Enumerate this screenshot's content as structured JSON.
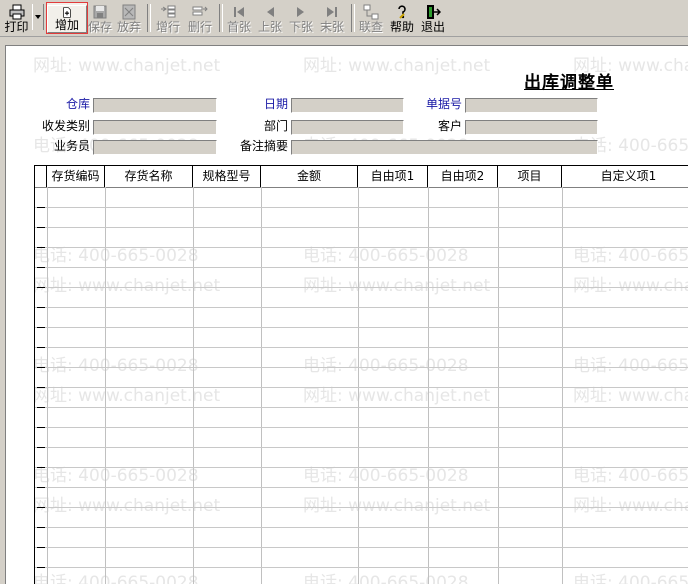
{
  "toolbar": {
    "buttons": [
      {
        "label": "打印",
        "icon": "printer-icon",
        "enabled": true
      },
      {
        "label": "增加",
        "icon": "add-document-icon",
        "enabled": true,
        "highlighted": true
      },
      {
        "label": "保存",
        "icon": "save-icon",
        "enabled": false
      },
      {
        "label": "放弃",
        "icon": "discard-icon",
        "enabled": false
      },
      {
        "label": "增行",
        "icon": "add-row-icon",
        "enabled": false
      },
      {
        "label": "删行",
        "icon": "delete-row-icon",
        "enabled": false
      },
      {
        "label": "首张",
        "icon": "first-record-icon",
        "enabled": false
      },
      {
        "label": "上张",
        "icon": "previous-record-icon",
        "enabled": false
      },
      {
        "label": "下张",
        "icon": "next-record-icon",
        "enabled": false
      },
      {
        "label": "末张",
        "icon": "last-record-icon",
        "enabled": false
      },
      {
        "label": "联查",
        "icon": "linked-query-icon",
        "enabled": false
      },
      {
        "label": "帮助",
        "icon": "help-icon",
        "enabled": true
      },
      {
        "label": "退出",
        "icon": "exit-icon",
        "enabled": true
      }
    ]
  },
  "form": {
    "title": "出库调整单",
    "fields": {
      "warehouse": {
        "label": "仓库",
        "value": ""
      },
      "date": {
        "label": "日期",
        "value": ""
      },
      "doc_no": {
        "label": "单据号",
        "value": ""
      },
      "io_type": {
        "label": "收发类别",
        "value": ""
      },
      "department": {
        "label": "部门",
        "value": ""
      },
      "customer": {
        "label": "客户",
        "value": ""
      },
      "salesperson": {
        "label": "业务员",
        "value": ""
      },
      "remark": {
        "label": "备注摘要",
        "value": ""
      }
    }
  },
  "grid": {
    "columns": [
      "存货编码",
      "存货名称",
      "规格型号",
      "金额",
      "自由项1",
      "自由项2",
      "项目",
      "自定义项1"
    ],
    "rows": []
  },
  "watermark": {
    "phone": "电话: 400-665-0028",
    "site": "网址: www.chanjet.net"
  },
  "colors": {
    "background": "#d4d0c8",
    "label_blue": "#1a1aa6",
    "highlight_border": "#e23b3b",
    "watermark": "#e6e6e6"
  }
}
